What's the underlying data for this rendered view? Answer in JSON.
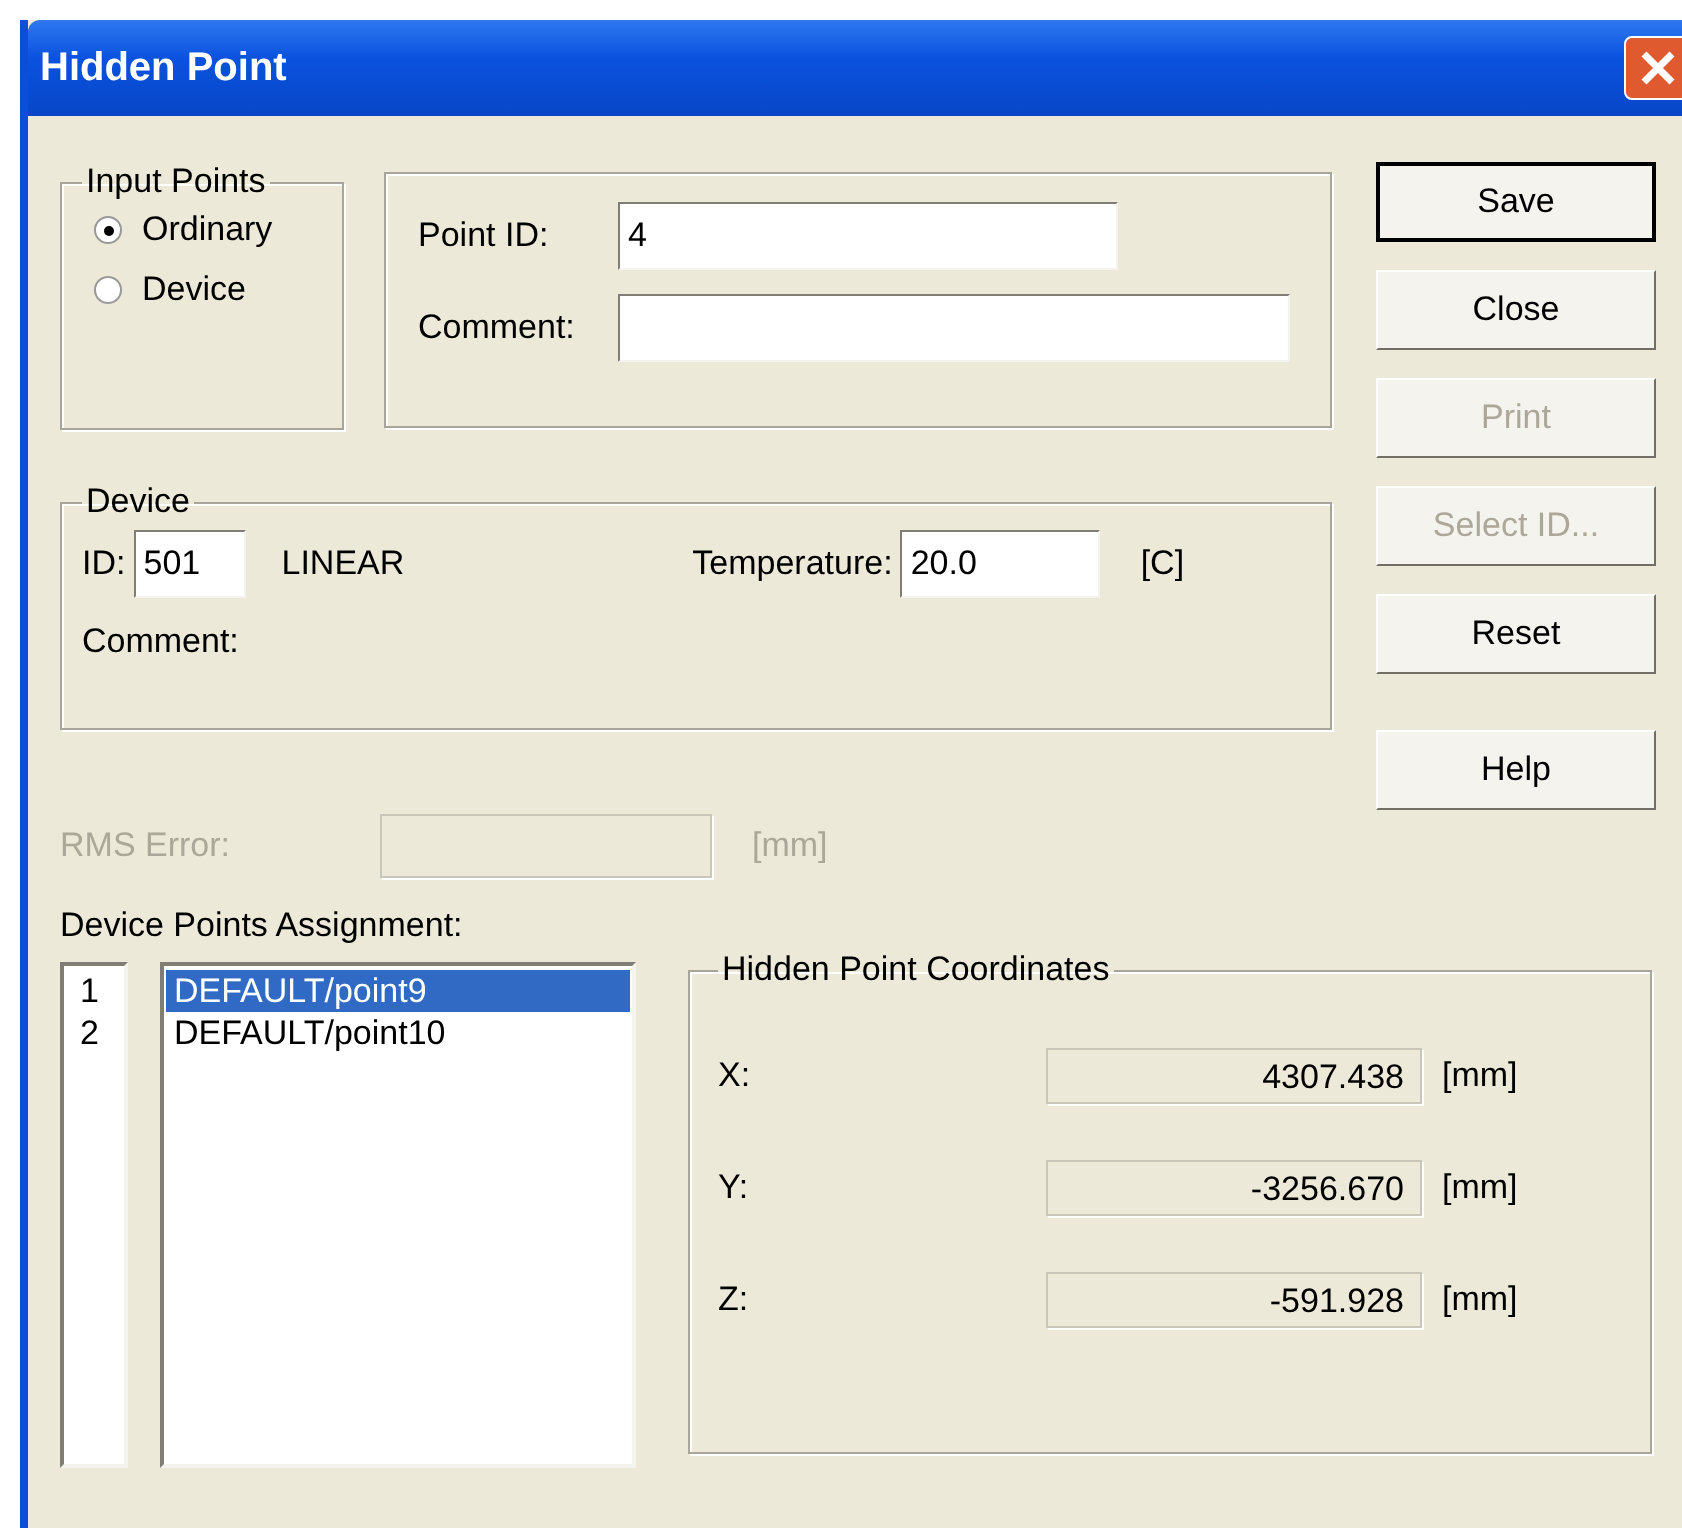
{
  "window": {
    "title": "Hidden Point"
  },
  "input_points": {
    "title": "Input Points",
    "options": [
      {
        "label": "Ordinary",
        "selected": true
      },
      {
        "label": "Device",
        "selected": false
      }
    ]
  },
  "point": {
    "point_id_label": "Point ID:",
    "point_id_value": "4",
    "comment_label": "Comment:"
  },
  "device": {
    "title": "Device",
    "id_label": "ID:",
    "id_value": "501",
    "type": "LINEAR",
    "temperature_label": "Temperature:",
    "temperature_value": "20.0",
    "temperature_unit": "[C]",
    "comment_label": "Comment:"
  },
  "rms": {
    "label": "RMS Error:",
    "unit": "[mm]",
    "disabled": true
  },
  "buttons": [
    {
      "label": "Save",
      "default": true,
      "disabled": false
    },
    {
      "label": "Close",
      "default": false,
      "disabled": false
    },
    {
      "label": "Print",
      "default": false,
      "disabled": true
    },
    {
      "label": "Select ID...",
      "default": false,
      "disabled": true
    },
    {
      "label": "Reset",
      "default": false,
      "disabled": false
    },
    {
      "label": "Help",
      "default": false,
      "disabled": false
    }
  ],
  "assignment": {
    "label": "Device Points Assignment:",
    "rows": [
      {
        "number": "1",
        "name": "DEFAULT/point9",
        "selected": true
      },
      {
        "number": "2",
        "name": "DEFAULT/point10",
        "selected": false
      }
    ]
  },
  "coordinates": {
    "title": "Hidden Point Coordinates",
    "rows": [
      {
        "axis": "X:",
        "value": "4307.438",
        "unit": "[mm]"
      },
      {
        "axis": "Y:",
        "value": "-3256.670",
        "unit": "[mm]"
      },
      {
        "axis": "Z:",
        "value": "-591.928",
        "unit": "[mm]"
      }
    ]
  }
}
